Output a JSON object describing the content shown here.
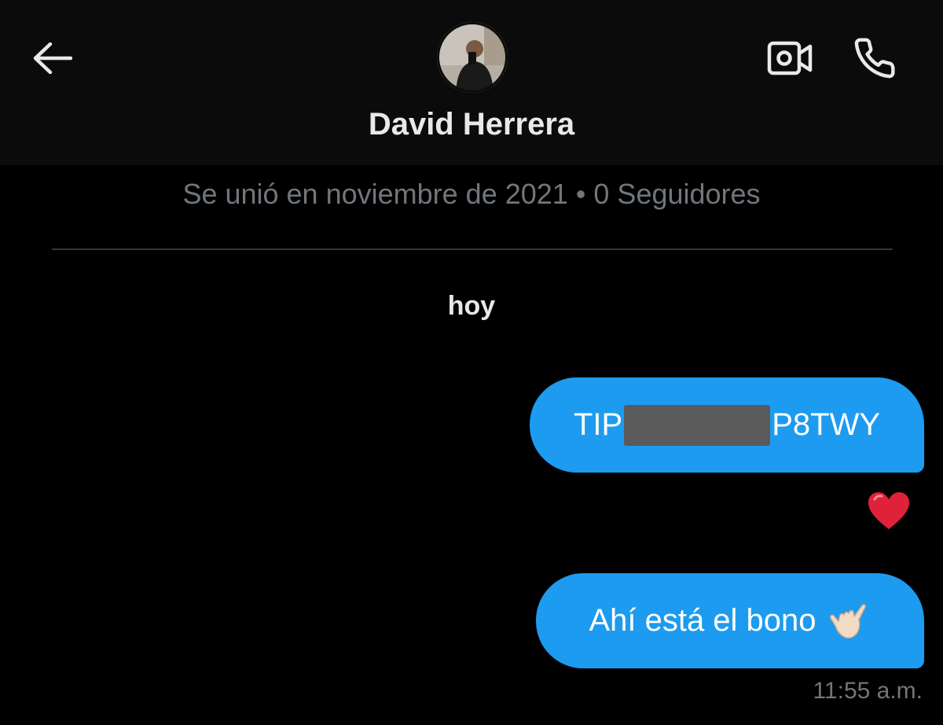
{
  "header": {
    "contact_name": "David Herrera",
    "back_icon": "arrow-left-icon",
    "video_icon": "video-camera-icon",
    "call_icon": "phone-icon"
  },
  "profile": {
    "meta": "Se unió en noviembre de 2021 • 0 Seguidores"
  },
  "conversation": {
    "date_separator": "hoy",
    "messages": [
      {
        "prefix": "TIP",
        "suffix": "P8TWY",
        "redacted": true,
        "reaction": "❤️"
      },
      {
        "text": "Ahí está el bono",
        "emoji": "shaka-hand",
        "time": "11:55 a.m."
      }
    ]
  },
  "colors": {
    "accent": "#1d9bf0",
    "background": "#000000",
    "muted": "#71767b"
  }
}
